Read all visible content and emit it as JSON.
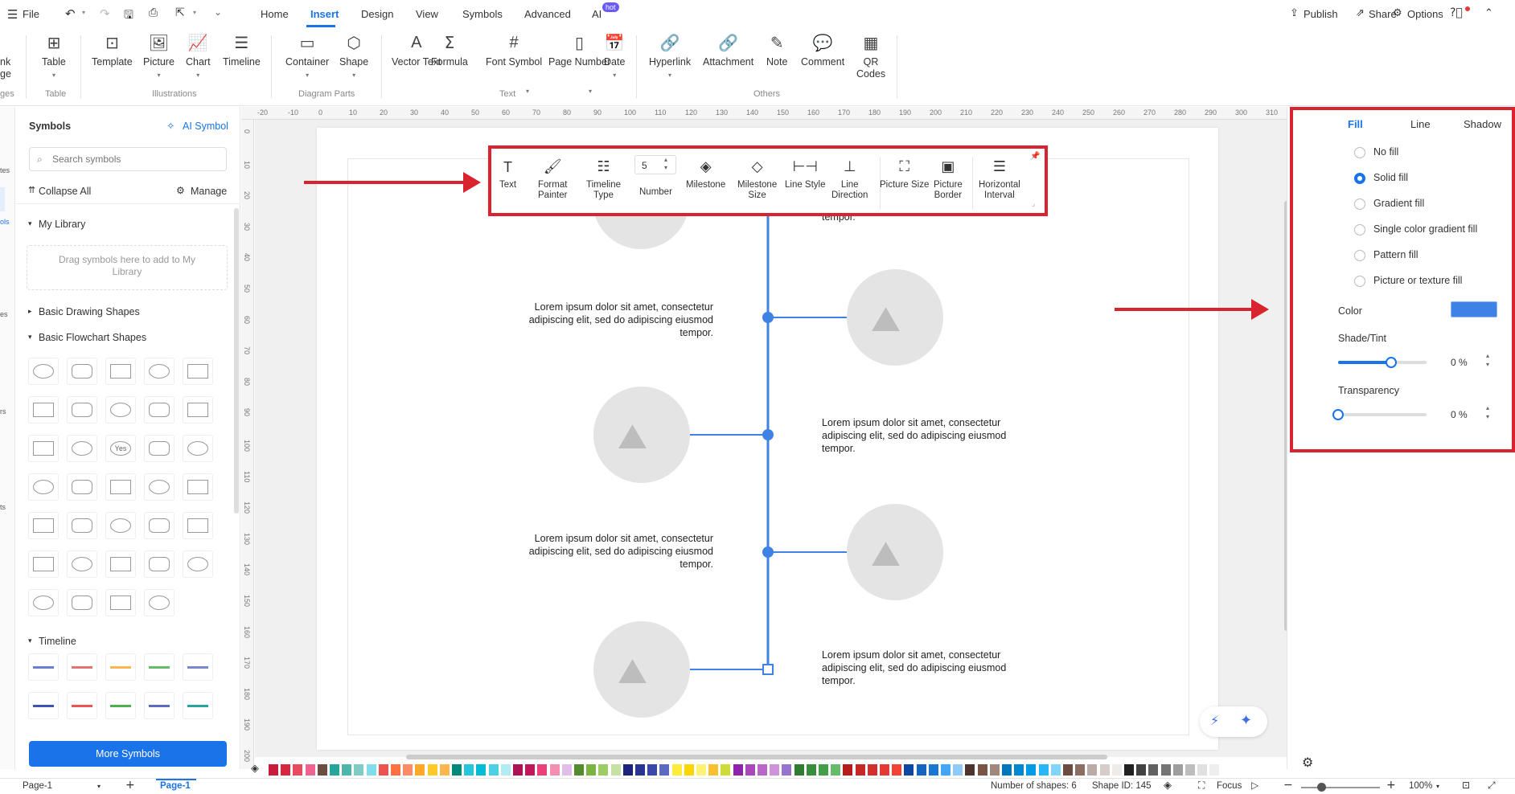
{
  "menu": {
    "file": "File",
    "tabs": [
      "Home",
      "Insert",
      "Design",
      "View",
      "Symbols",
      "Advanced",
      "AI"
    ],
    "hot": "hot",
    "publish": "Publish",
    "share": "Share",
    "options": "Options"
  },
  "ribbon": {
    "partial": [
      "nk",
      "ge"
    ],
    "buttons": [
      "Table",
      "Template",
      "Picture",
      "Chart",
      "Timeline",
      "Container",
      "Shape",
      "Vector Text",
      "Formula",
      "Font Symbol",
      "Page Number",
      "Date",
      "Hyperlink",
      "Attachment",
      "Note",
      "Comment",
      "QR Codes"
    ],
    "groups": [
      "ges",
      "Table",
      "Illustrations",
      "Diagram Parts",
      "Text",
      "Others"
    ]
  },
  "lstrip": [
    "tes",
    "ols",
    "es",
    "rs",
    "ts"
  ],
  "sidebar": {
    "title": "Symbols",
    "ai_symbol": "AI Symbol",
    "search_placeholder": "Search symbols",
    "collapse_all": "Collapse All",
    "manage": "Manage",
    "my_library": "My Library",
    "drop_hint": "Drag symbols here to add to My Library",
    "basic_drawing": "Basic Drawing Shapes",
    "basic_flowchart": "Basic Flowchart Shapes",
    "yes_label": "Yes",
    "timeline": "Timeline",
    "more_symbols": "More Symbols"
  },
  "hruler": [
    "-20",
    "-10",
    "0",
    "10",
    "20",
    "30",
    "40",
    "50",
    "60",
    "70",
    "80",
    "90",
    "100",
    "110",
    "120",
    "130",
    "140",
    "150",
    "160",
    "170",
    "180",
    "190",
    "200",
    "210",
    "220",
    "230",
    "240",
    "250",
    "260",
    "270",
    "280",
    "290",
    "300",
    "310"
  ],
  "vruler": [
    "0",
    "10",
    "20",
    "30",
    "40",
    "50",
    "60",
    "70",
    "80",
    "90",
    "100",
    "110",
    "120",
    "130",
    "140",
    "150",
    "160",
    "170",
    "180",
    "190",
    "200"
  ],
  "float_toolbar": {
    "text": "Text",
    "format_painter": [
      "Format",
      "Painter"
    ],
    "timeline_type": [
      "Timeline",
      "Type"
    ],
    "number_value": "5",
    "number": "Number",
    "milestone": "Milestone",
    "milestone_size": [
      "Milestone",
      "Size"
    ],
    "line_style": "Line Style",
    "line_direction": [
      "Line",
      "Direction"
    ],
    "picture_size": "Picture Size",
    "picture_border": [
      "Picture",
      "Border"
    ],
    "horizontal_interval": [
      "Horizontal",
      "Interval"
    ]
  },
  "canvas": {
    "top_text": "tempor.",
    "lorem": [
      "Lorem ipsum dolor sit amet, consectetur",
      "adipiscing elit, sed do adipiscing eiusmod",
      "tempor."
    ]
  },
  "right_panel": {
    "tabs": [
      "Fill",
      "Line",
      "Shadow"
    ],
    "options": [
      "No fill",
      "Solid fill",
      "Gradient fill",
      "Single color gradient fill",
      "Pattern fill",
      "Picture or texture fill"
    ],
    "selected": "Solid fill",
    "color_label": "Color",
    "color_value": "#3f82e6",
    "shade_label": "Shade/Tint",
    "shade_value": "0 %",
    "shade_level": 0.6,
    "transparency_label": "Transparency",
    "transparency_value": "0 %",
    "transparency_level": 0
  },
  "status": {
    "page_select": "Page-1",
    "page_tab": "Page-1",
    "shapes": "Number of shapes: 6",
    "shape_id": "Shape ID: 145",
    "focus": "Focus",
    "zoom": "100%"
  },
  "palette": [
    "#c81d3a",
    "#d7263d",
    "#e84a5f",
    "#f06292",
    "#6d4c41",
    "#26a69a",
    "#4db6ac",
    "#80cbc4",
    "#80deea",
    "#ef5350",
    "#ff7043",
    "#ff8a65",
    "#ffa726",
    "#ffca28",
    "#ffb74d",
    "#00897b",
    "#26c6da",
    "#00bcd4",
    "#4dd0e1",
    "#b2ebf2",
    "#ad1457",
    "#c2185b",
    "#ec407a",
    "#f48fb1",
    "#e1bee7",
    "#558b2f",
    "#7cb342",
    "#9ccc65",
    "#c5e1a5",
    "#1a237e",
    "#283593",
    "#3949ab",
    "#5c6bc0",
    "#ffeb3b",
    "#ffd600",
    "#fff176",
    "#fbc02d",
    "#cddc39",
    "#8e24aa",
    "#ab47bc",
    "#ba68c8",
    "#ce93d8",
    "#9575cd",
    "#2e7d32",
    "#388e3c",
    "#43a047",
    "#66bb6a",
    "#b71c1c",
    "#c62828",
    "#d32f2f",
    "#e53935",
    "#f44336",
    "#0d47a1",
    "#1565c0",
    "#1976d2",
    "#42a5f5",
    "#90caf9",
    "#4e342e",
    "#795548",
    "#a1887f",
    "#0277bd",
    "#0288d1",
    "#039be5",
    "#29b6f6",
    "#81d4fa",
    "#6d4c41",
    "#8d6e63",
    "#bcaaa4",
    "#d7ccc8",
    "#efebe9",
    "#212121",
    "#424242",
    "#616161",
    "#757575",
    "#9e9e9e",
    "#bdbdbd",
    "#e0e0e0",
    "#eeeeee"
  ]
}
